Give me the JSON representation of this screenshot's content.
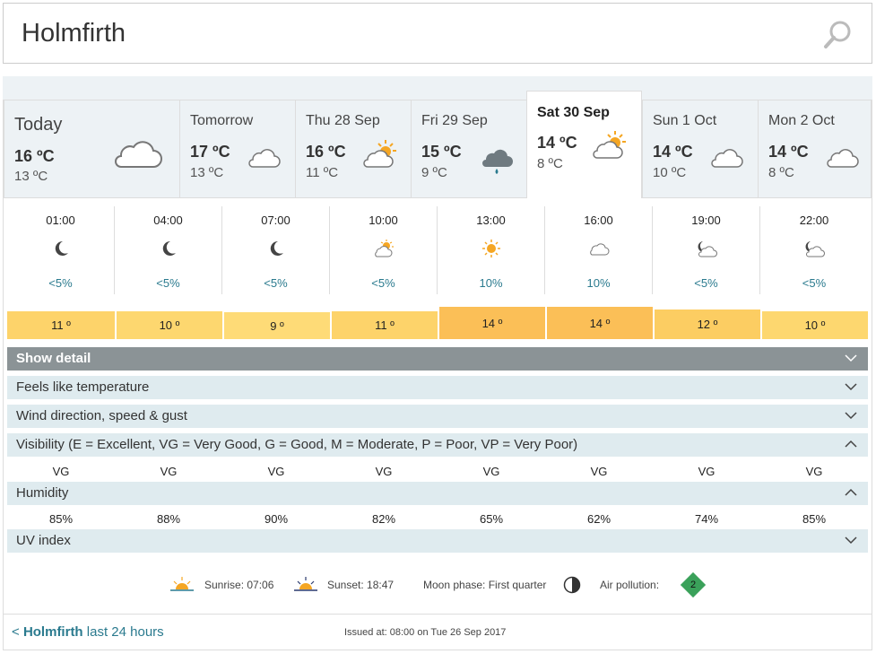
{
  "search": {
    "location": "Holmfirth"
  },
  "days": [
    {
      "name": "Today",
      "high": "16 ºC",
      "low": "13 ºC",
      "icon": "cloud-icon"
    },
    {
      "name": "Tomorrow",
      "high": "17 ºC",
      "low": "13 ºC",
      "icon": "cloud-icon"
    },
    {
      "name": "Thu 28 Sep",
      "high": "16 ºC",
      "low": "11 ºC",
      "icon": "sun-cloud-icon"
    },
    {
      "name": "Fri 29 Sep",
      "high": "15 ºC",
      "low": "9 ºC",
      "icon": "rain-cloud-icon"
    },
    {
      "name": "Sat 30 Sep",
      "high": "14 ºC",
      "low": "8 ºC",
      "icon": "sun-cloud-icon"
    },
    {
      "name": "Sun 1 Oct",
      "high": "14 ºC",
      "low": "10 ºC",
      "icon": "cloud-icon"
    },
    {
      "name": "Mon 2 Oct",
      "high": "14 ºC",
      "low": "8 ºC",
      "icon": "cloud-icon"
    }
  ],
  "hours": [
    {
      "time": "01:00",
      "precip": "<5%",
      "temp": "11 º",
      "icon": "moon-icon",
      "temp_color": "#fdd36a"
    },
    {
      "time": "04:00",
      "precip": "<5%",
      "temp": "10 º",
      "icon": "moon-icon",
      "temp_color": "#fdd76f"
    },
    {
      "time": "07:00",
      "precip": "<5%",
      "temp": "9 º",
      "icon": "moon-icon",
      "temp_color": "#fedb77"
    },
    {
      "time": "10:00",
      "precip": "<5%",
      "temp": "11 º",
      "icon": "sun-cloud-icon",
      "temp_color": "#fdd36a"
    },
    {
      "time": "13:00",
      "precip": "10%",
      "temp": "14 º",
      "icon": "sun-icon",
      "temp_color": "#fbbf57"
    },
    {
      "time": "16:00",
      "precip": "10%",
      "temp": "14 º",
      "icon": "cloud-icon",
      "temp_color": "#fbbf57"
    },
    {
      "time": "19:00",
      "precip": "<5%",
      "temp": "12 º",
      "icon": "moon-cloud-icon",
      "temp_color": "#fccd62"
    },
    {
      "time": "22:00",
      "precip": "<5%",
      "temp": "10 º",
      "icon": "moon-cloud-icon",
      "temp_color": "#fdd76f"
    }
  ],
  "detail": {
    "show_detail": "Show detail",
    "feels_like": "Feels like temperature",
    "wind": "Wind direction, speed & gust",
    "visibility": "Visibility (E = Excellent, VG = Very Good, G = Good, M = Moderate, P = Poor, VP = Very Poor)",
    "visibility_values": [
      "VG",
      "VG",
      "VG",
      "VG",
      "VG",
      "VG",
      "VG",
      "VG"
    ],
    "humidity": "Humidity",
    "humidity_values": [
      "85%",
      "88%",
      "90%",
      "82%",
      "65%",
      "62%",
      "74%",
      "85%"
    ],
    "uv": "UV index"
  },
  "footer": {
    "sunrise": "Sunrise: 07:06",
    "sunset": "Sunset: 18:47",
    "moon": "Moon phase: First quarter",
    "air": "Air pollution:",
    "air_value": "2",
    "air_color": "#3aa15a"
  },
  "bottom": {
    "link_prefix": "< ",
    "link_place": "Holmfirth",
    "link_rest": " last 24 hours",
    "issued": "Issued at: 08:00 on Tue 26 Sep 2017"
  }
}
